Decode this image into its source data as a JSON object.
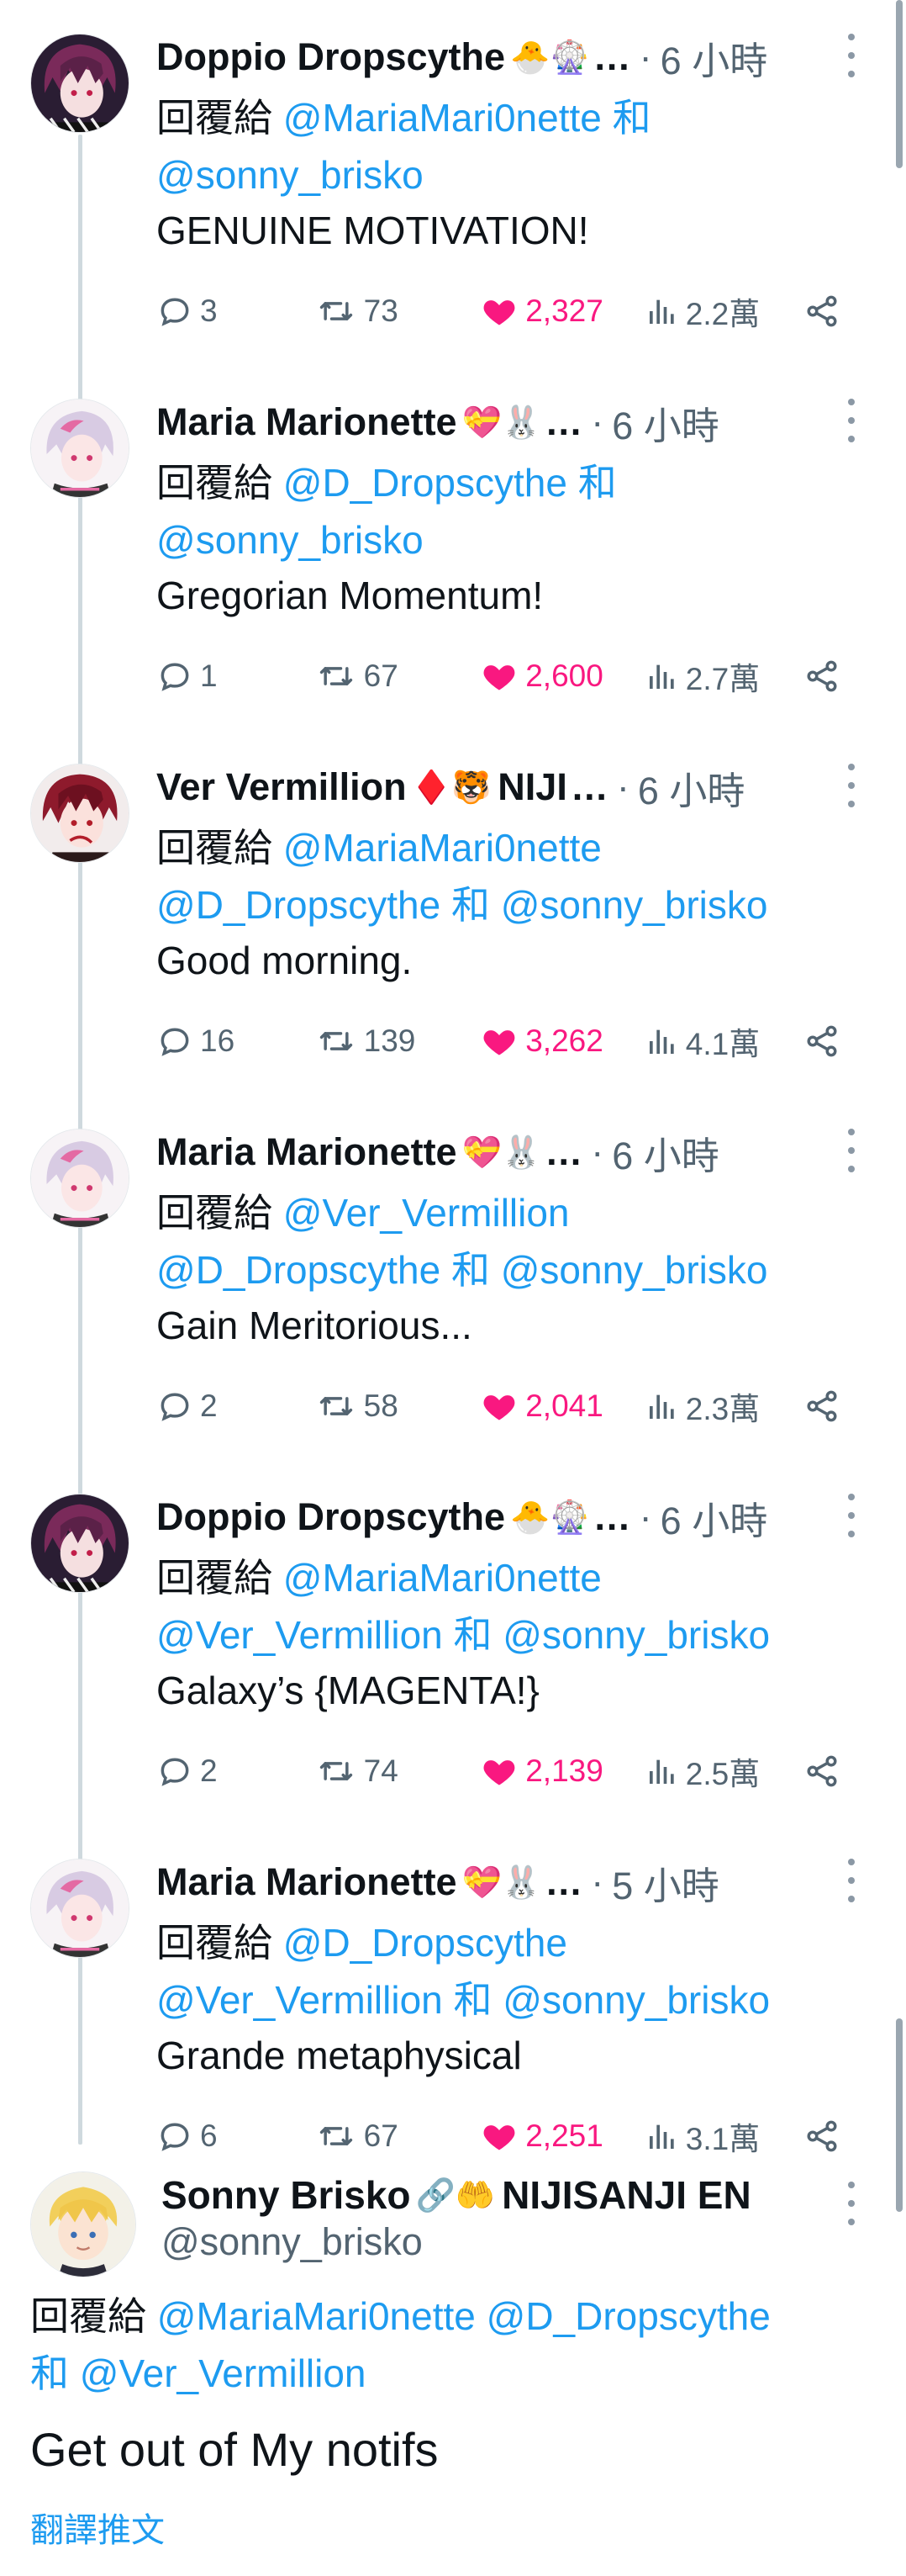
{
  "tweets": [
    {
      "name": "Doppio Dropscythe",
      "emojis": "🐣🎡",
      "time": "6 小時",
      "reply_prefix": "回覆給",
      "reply_line1": "@MariaMari0nette 和",
      "reply_line2": "@sonny_brisko",
      "reply_line1_mention": "@MariaMari0nette",
      "reply_line1_suffix": "和",
      "reply_line2_mention": "@sonny_brisko",
      "reply_line2_suffix": "",
      "text": "GENUINE MOTIVATION!",
      "replies": "3",
      "retweets": "73",
      "likes": "2,327",
      "views": "2.2萬",
      "avatar": "doppio"
    },
    {
      "name": "Maria Marionette",
      "emojis": "💝🐰",
      "time": "6 小時",
      "reply_prefix": "回覆給",
      "reply_line1_mention": "@D_Dropscythe",
      "reply_line1_suffix": "和",
      "reply_line2_mention": "@sonny_brisko",
      "reply_line2_suffix": "",
      "text": "Gregorian Momentum!",
      "replies": "1",
      "retweets": "67",
      "likes": "2,600",
      "views": "2.7萬",
      "avatar": "maria"
    },
    {
      "name": "Ver Vermillion",
      "emojis": "♦️🐯",
      "name_suffix": "NIJI",
      "time": "6 小時",
      "reply_prefix": "回覆給",
      "reply_line1_mention": "@MariaMari0nette",
      "reply_line1_suffix": "",
      "reply_line2_mention": "@D_Dropscythe",
      "reply_line2_suffix": "和",
      "reply_line2_mention2": "@sonny_brisko",
      "text": "Good morning.",
      "replies": "16",
      "retweets": "139",
      "likes": "3,262",
      "views": "4.1萬",
      "avatar": "ver"
    },
    {
      "name": "Maria Marionette",
      "emojis": "💝🐰",
      "time": "6 小時",
      "reply_prefix": "回覆給",
      "reply_line1_mention": "@Ver_Vermillion",
      "reply_line1_suffix": "",
      "reply_line2_mention": "@D_Dropscythe",
      "reply_line2_suffix": "和",
      "reply_line2_mention2": "@sonny_brisko",
      "text": "Gain Meritorious...",
      "replies": "2",
      "retweets": "58",
      "likes": "2,041",
      "views": "2.3萬",
      "avatar": "maria"
    },
    {
      "name": "Doppio Dropscythe",
      "emojis": "🐣🎡",
      "time": "6 小時",
      "reply_prefix": "回覆給",
      "reply_line1_mention": "@MariaMari0nette",
      "reply_line1_suffix": "",
      "reply_line2_mention": "@Ver_Vermillion",
      "reply_line2_suffix": "和",
      "reply_line2_mention2": "@sonny_brisko",
      "text": "Galaxy’s {MAGENTA!}",
      "replies": "2",
      "retweets": "74",
      "likes": "2,139",
      "views": "2.5萬",
      "avatar": "doppio"
    },
    {
      "name": "Maria Marionette",
      "emojis": "💝🐰",
      "time": "5 小時",
      "reply_prefix": "回覆給",
      "reply_line1_mention": "@D_Dropscythe",
      "reply_line1_suffix": "",
      "reply_line2_mention": "@Ver_Vermillion",
      "reply_line2_suffix": "和",
      "reply_line2_mention2": "@sonny_brisko",
      "text": "Grande metaphysical",
      "replies": "6",
      "retweets": "67",
      "likes": "2,251",
      "views": "3.1萬",
      "avatar": "maria"
    }
  ],
  "main_tweet": {
    "name": "Sonny Brisko",
    "emojis": "🔗🤲",
    "name_suffix": "NIJISANJI EN",
    "handle": "@sonny_brisko",
    "reply_prefix": "回覆給",
    "mention1": "@MariaMari0nette",
    "mention2": "@D_Dropscythe",
    "and_word": "和",
    "mention3": "@Ver_Vermillion",
    "text": "Get out of My notifs",
    "translate_label": "翻譯推文"
  },
  "colors": {
    "link": "#1d9bf0",
    "like": "#f91880",
    "muted": "#536471",
    "thread_line": "#cfd9de"
  },
  "icons": {
    "reply": "reply-icon",
    "retweet": "retweet-icon",
    "like": "heart-icon",
    "views": "views-icon",
    "share": "share-icon",
    "more": "more-icon"
  }
}
